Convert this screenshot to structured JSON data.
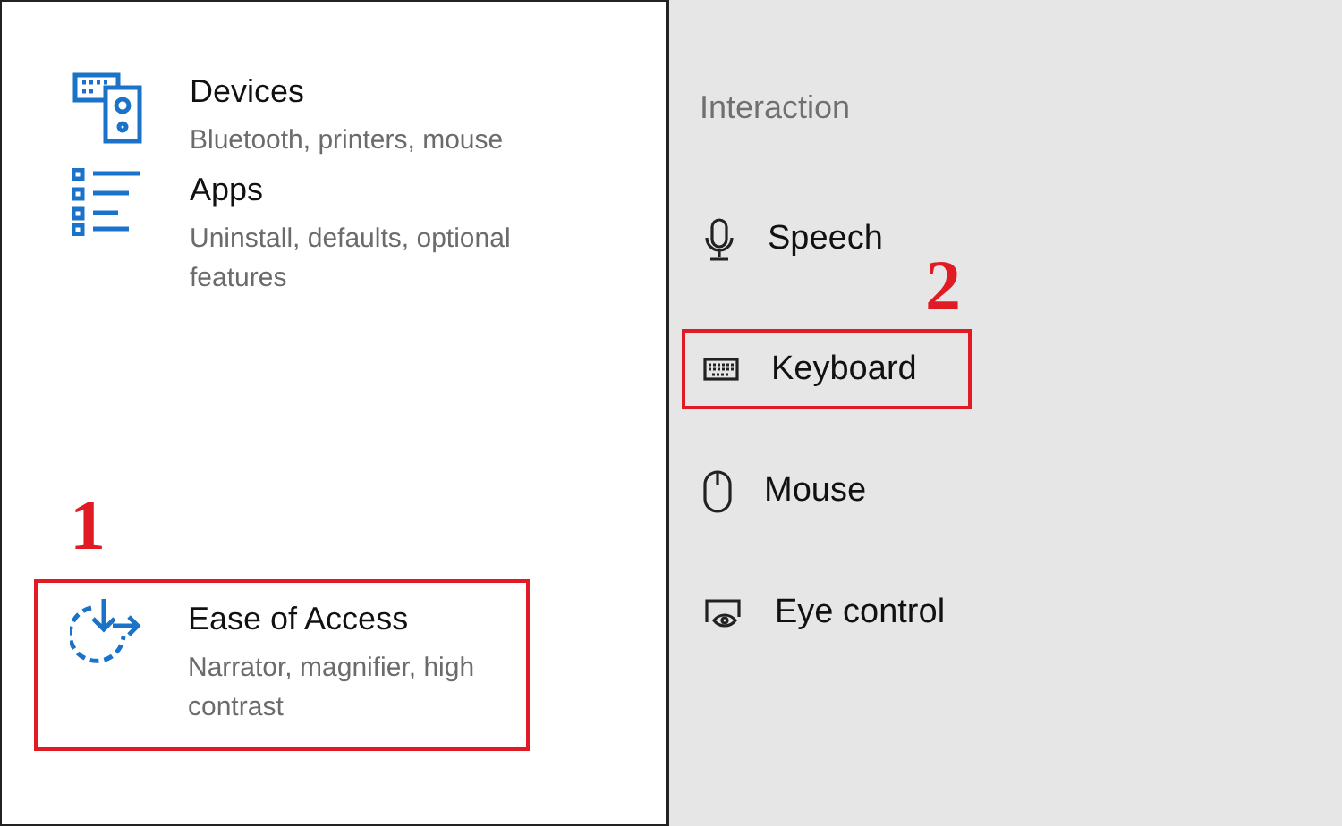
{
  "categories": [
    {
      "kind": "devices",
      "title": "Devices",
      "subtitle": "Bluetooth, printers, mouse",
      "highlighted": false
    },
    {
      "kind": "apps",
      "title": "Apps",
      "subtitle": "Uninstall, defaults, optional features",
      "highlighted": false
    },
    {
      "kind": "ease",
      "title": "Ease of Access",
      "subtitle": "Narrator, magnifier, high contrast",
      "highlighted": true,
      "step": "1"
    }
  ],
  "interaction": {
    "heading": "Interaction",
    "items": [
      {
        "kind": "speech",
        "label": "Speech",
        "highlighted": false
      },
      {
        "kind": "keyboard",
        "label": "Keyboard",
        "highlighted": true,
        "step": "2"
      },
      {
        "kind": "mouse",
        "label": "Mouse",
        "highlighted": false
      },
      {
        "kind": "eye",
        "label": "Eye control",
        "highlighted": false
      }
    ]
  }
}
